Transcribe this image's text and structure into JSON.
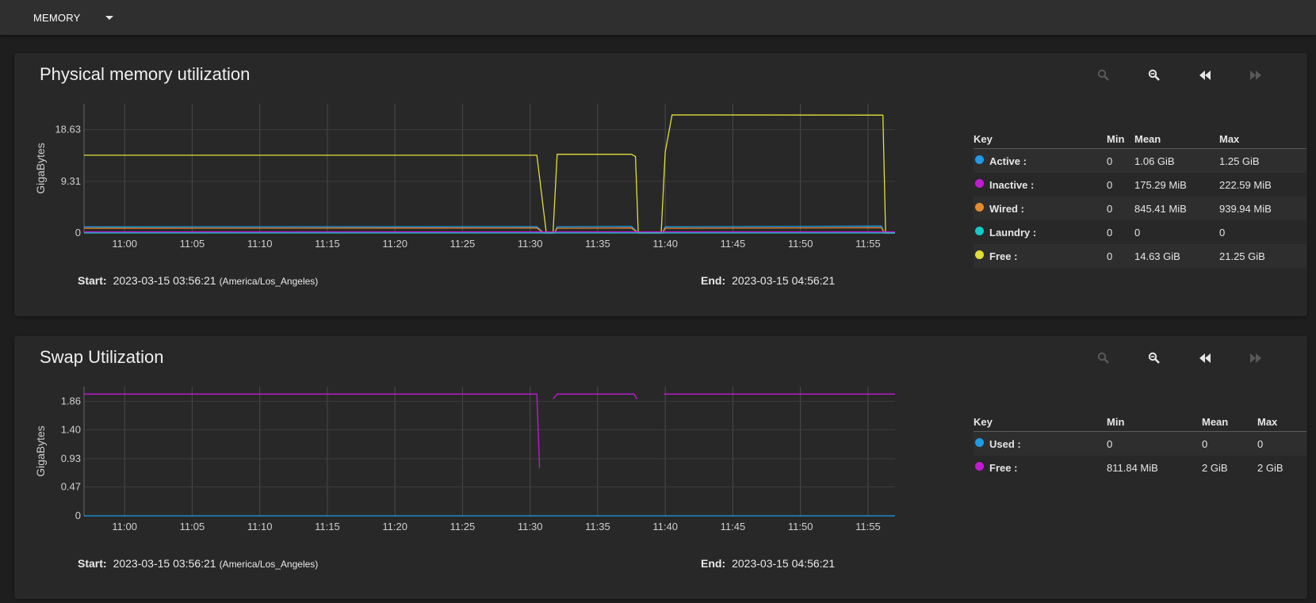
{
  "header": {
    "report_label": "MEMORY"
  },
  "icons": {
    "zoom_in": "zoom-in-icon",
    "zoom_out": "zoom-out-icon",
    "step_back": "step-backward-icon",
    "step_forward": "step-forward-icon"
  },
  "colors": {
    "active": "#1e9be8",
    "inactive": "#c31ad6",
    "wired": "#e8892e",
    "laundry": "#16c9c9",
    "free": "#e1df3a"
  },
  "physical": {
    "title": "Physical memory utilization",
    "start_label": "Start:",
    "start_value": "2023-03-15 03:56:21",
    "timezone": "(America/Los_Angeles)",
    "end_label": "End:",
    "end_value": "2023-03-15 04:56:21",
    "legend": {
      "headers": {
        "key": "Key",
        "min": "Min",
        "mean": "Mean",
        "max": "Max"
      },
      "rows": [
        {
          "name": "Active :",
          "min": "0",
          "mean": "1.06 GiB",
          "max": "1.25 GiB",
          "color": "#1e9be8"
        },
        {
          "name": "Inactive :",
          "min": "0",
          "mean": "175.29 MiB",
          "max": "222.59 MiB",
          "color": "#c31ad6"
        },
        {
          "name": "Wired :",
          "min": "0",
          "mean": "845.41 MiB",
          "max": "939.94 MiB",
          "color": "#e8892e"
        },
        {
          "name": "Laundry :",
          "min": "0",
          "mean": "0",
          "max": "0",
          "color": "#16c9c9"
        },
        {
          "name": "Free :",
          "min": "0",
          "mean": "14.63 GiB",
          "max": "21.25 GiB",
          "color": "#e1df3a"
        }
      ]
    }
  },
  "swap": {
    "title": "Swap Utilization",
    "start_label": "Start:",
    "start_value": "2023-03-15 03:56:21",
    "timezone": "(America/Los_Angeles)",
    "end_label": "End:",
    "end_value": "2023-03-15 04:56:21",
    "legend": {
      "headers": {
        "key": "Key",
        "min": "Min",
        "mean": "Mean",
        "max": "Max"
      },
      "rows": [
        {
          "name": "Used :",
          "min": "0",
          "mean": "0",
          "max": "0",
          "color": "#1e9be8"
        },
        {
          "name": "Free :",
          "min": "811.84 MiB",
          "mean": "2 GiB",
          "max": "2 GiB",
          "color": "#c31ad6"
        }
      ]
    }
  },
  "chart_data": [
    {
      "type": "line",
      "title": "Physical memory utilization",
      "ylabel": "GigaBytes",
      "xlabel": "",
      "x_unit": "time (HH:MM)",
      "xlim": [
        "10:57",
        "11:57"
      ],
      "x_ticks": [
        "11:00",
        "11:05",
        "11:10",
        "11:15",
        "11:20",
        "11:25",
        "11:30",
        "11:35",
        "11:40",
        "11:45",
        "11:50",
        "11:55"
      ],
      "y_ticks": [
        "0",
        "9.31",
        "18.63"
      ],
      "ylim": [
        0,
        23.3
      ],
      "grid": true,
      "series": [
        {
          "name": "Free",
          "color": "#e1df3a",
          "x": [
            "10:57",
            "11:30.5",
            "11:31.2",
            "11:31.7",
            "11:32",
            "11:37.5",
            "11:37.8",
            "11:38",
            "11:39.7",
            "11:40",
            "11:40.5",
            "11:56.1",
            "11:56.3",
            "11:57"
          ],
          "y": [
            14.02,
            14.02,
            0,
            0,
            14.2,
            14.2,
            13.8,
            0,
            0,
            14.6,
            21.3,
            21.25,
            0,
            0
          ]
        },
        {
          "name": "Active",
          "color": "#1e9be8",
          "x": [
            "10:57",
            "11:30.5",
            "11:31",
            "11:31.8",
            "11:32",
            "11:37.5",
            "11:38",
            "11:39.8",
            "11:40",
            "11:56",
            "11:56.2",
            "11:57"
          ],
          "y": [
            1.1,
            1.15,
            0,
            0,
            1.1,
            1.2,
            0,
            0,
            1.1,
            1.25,
            0,
            0
          ]
        },
        {
          "name": "Wired",
          "color": "#e8892e",
          "x": [
            "10:57",
            "11:30.5",
            "11:31",
            "11:31.8",
            "11:32",
            "11:37.5",
            "11:38",
            "11:39.8",
            "11:40",
            "11:56",
            "11:56.2",
            "11:57"
          ],
          "y": [
            0.85,
            0.9,
            0,
            0,
            0.85,
            0.9,
            0,
            0,
            0.85,
            0.94,
            0,
            0
          ]
        },
        {
          "name": "Inactive",
          "color": "#c31ad6",
          "x": [
            "10:57",
            "11:57"
          ],
          "y": [
            0.18,
            0.18
          ]
        },
        {
          "name": "Laundry",
          "color": "#16c9c9",
          "x": [
            "10:57",
            "11:57"
          ],
          "y": [
            0,
            0
          ]
        }
      ]
    },
    {
      "type": "line",
      "title": "Swap Utilization",
      "ylabel": "GigaBytes",
      "xlabel": "",
      "x_unit": "time (HH:MM)",
      "xlim": [
        "10:57",
        "11:57"
      ],
      "x_ticks": [
        "11:00",
        "11:05",
        "11:10",
        "11:15",
        "11:20",
        "11:25",
        "11:30",
        "11:35",
        "11:40",
        "11:45",
        "11:50",
        "11:55"
      ],
      "y_ticks": [
        "0",
        "0.47",
        "0.93",
        "1.40",
        "1.86"
      ],
      "ylim": [
        0,
        2.1
      ],
      "grid": true,
      "series": [
        {
          "name": "Free",
          "color": "#c31ad6",
          "segments": [
            {
              "x": [
                "10:57",
                "11:30.5",
                "11:30.7"
              ],
              "y": [
                1.98,
                1.98,
                0.78
              ]
            },
            {
              "x": [
                "11:31.7",
                "11:32",
                "11:37.7",
                "11:37.9"
              ],
              "y": [
                1.9,
                1.98,
                1.98,
                1.9
              ]
            },
            {
              "x": [
                "11:39.9",
                "11:57"
              ],
              "y": [
                1.98,
                1.98
              ]
            }
          ]
        },
        {
          "name": "Used",
          "color": "#1e9be8",
          "segments": [
            {
              "x": [
                "10:57",
                "11:57"
              ],
              "y": [
                0,
                0
              ]
            }
          ]
        }
      ]
    }
  ]
}
